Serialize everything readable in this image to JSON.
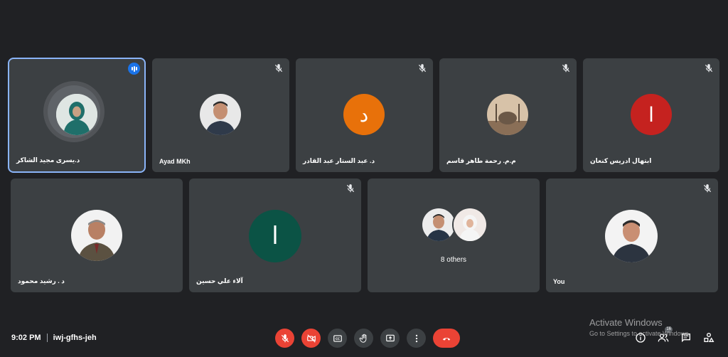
{
  "participants": [
    {
      "name": "د.يسرى مجيد الشاكر",
      "avatar": "photo-woman-hijab-icon",
      "speaking": true
    },
    {
      "name": "Ayad MKh",
      "avatar": "photo-man-icon",
      "muted": true
    },
    {
      "name": "د. عبد الستار عبد القادر",
      "initial": "د",
      "color": "#e8710a",
      "muted": true
    },
    {
      "name": "م.م. رحمة طاهر قاسم",
      "avatar": "photo-mosque-icon",
      "muted": true
    },
    {
      "name": "ابتهال ادريس كنعان",
      "initial": "ا",
      "color": "#c5221f",
      "muted": true
    },
    {
      "name": "د . رشيد محمود",
      "avatar": "photo-older-man-icon"
    },
    {
      "name": "آلاء علي حسين",
      "initial": "ا",
      "color": "#0b5345",
      "muted": true
    },
    {
      "others_label": "8 others"
    },
    {
      "name": "You",
      "avatar": "photo-man-icon",
      "muted": true
    }
  ],
  "meeting": {
    "time": "9:02 PM",
    "code": "iwj-gfhs-jeh"
  },
  "people_count": "16",
  "watermark": {
    "line1": "Activate Windows",
    "line2": "Go to Settings to activate Windows."
  },
  "colors": {
    "background": "#202124",
    "tile": "#3c4043",
    "accent_red": "#ea4335",
    "speaking_blue": "#1a73e8"
  }
}
